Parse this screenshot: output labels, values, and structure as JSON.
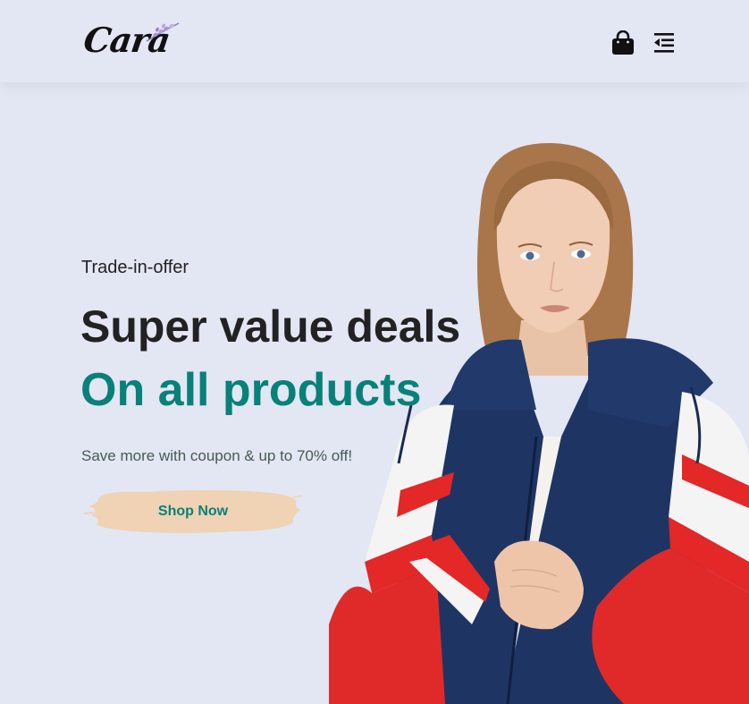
{
  "header": {
    "logo_text": "Cara",
    "icons": {
      "cart": "shopping-bag-icon",
      "menu": "menu-outdent-icon"
    }
  },
  "hero": {
    "kicker": "Trade-in-offer",
    "headline": "Super value deals",
    "subhead": "On all products",
    "description": "Save more with coupon & up to 70% off!",
    "button_label": "Shop Now"
  },
  "colors": {
    "background": "#e3e6f3",
    "accent": "#088178",
    "button_brush": "#f0d2b4",
    "text_dark": "#222222"
  }
}
